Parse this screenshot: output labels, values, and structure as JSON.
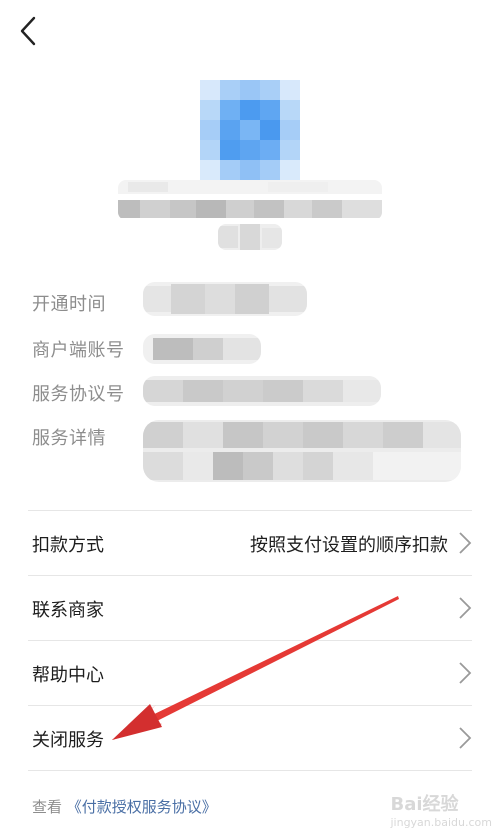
{
  "nav": {
    "back_icon": "chevron-left-icon"
  },
  "info_labels": {
    "open_time": "开通时间",
    "merchant_account": "商户端账号",
    "agreement_no": "服务协议号",
    "service_detail": "服务详情"
  },
  "menu": {
    "deduct_method": {
      "label": "扣款方式",
      "value": "按照支付设置的顺序扣款"
    },
    "contact_merchant": {
      "label": "联系商家"
    },
    "help_center": {
      "label": "帮助中心"
    },
    "close_service": {
      "label": "关闭服务"
    }
  },
  "footer": {
    "prefix": "查看",
    "link": "《付款授权服务协议》"
  },
  "watermark": {
    "text": "Bai经验",
    "sub": "jingyan.baidu.com"
  },
  "colors": {
    "arrow": "#e53935",
    "logo": "#4a9df0"
  }
}
